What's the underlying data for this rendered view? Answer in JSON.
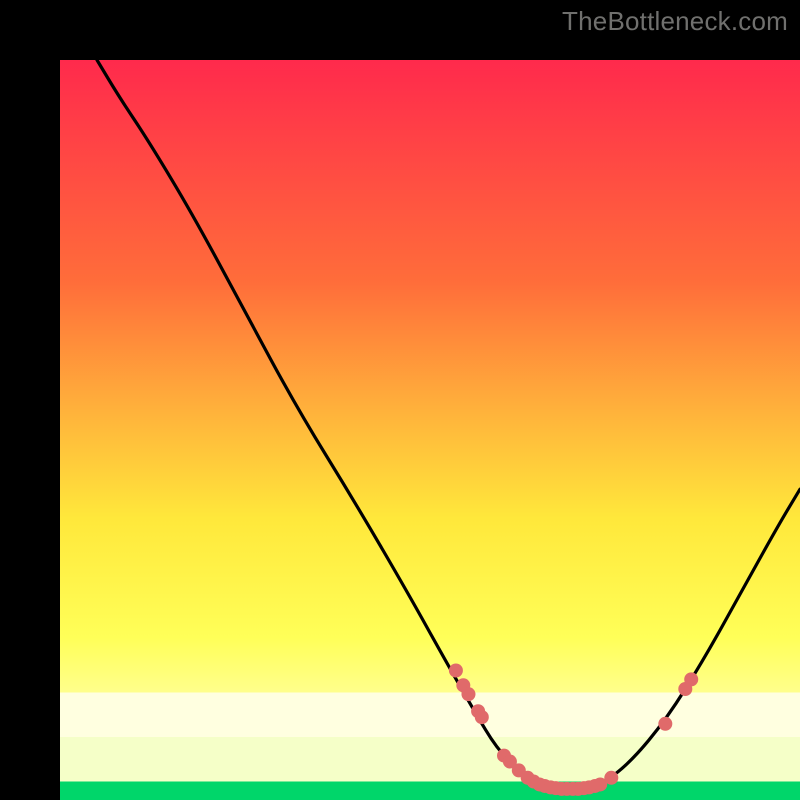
{
  "watermark": "TheBottleneck.com",
  "chart_data": {
    "type": "line",
    "xlabel": "",
    "ylabel": "",
    "xlim": [
      0,
      100
    ],
    "ylim": [
      0,
      100
    ],
    "title": "",
    "grid": false,
    "background_gradient": {
      "top": "#ff2a4c",
      "mid_upper": "#ffb43b",
      "mid": "#ffe83b",
      "mid_lower": "#ffff8c",
      "bottom_band": "#ffffe0",
      "bottom_line": "#00d66a"
    },
    "curve": [
      {
        "x": 5.0,
        "y": 100.0
      },
      {
        "x": 8.0,
        "y": 95.0
      },
      {
        "x": 12.0,
        "y": 89.0
      },
      {
        "x": 18.0,
        "y": 79.0
      },
      {
        "x": 25.0,
        "y": 66.0
      },
      {
        "x": 32.0,
        "y": 53.0
      },
      {
        "x": 40.0,
        "y": 40.0
      },
      {
        "x": 47.0,
        "y": 28.0
      },
      {
        "x": 52.0,
        "y": 19.0
      },
      {
        "x": 56.0,
        "y": 12.0
      },
      {
        "x": 59.0,
        "y": 7.0
      },
      {
        "x": 62.0,
        "y": 4.0
      },
      {
        "x": 65.0,
        "y": 2.0
      },
      {
        "x": 69.0,
        "y": 1.5
      },
      {
        "x": 73.0,
        "y": 2.0
      },
      {
        "x": 77.0,
        "y": 5.0
      },
      {
        "x": 82.0,
        "y": 11.0
      },
      {
        "x": 87.0,
        "y": 19.0
      },
      {
        "x": 92.0,
        "y": 28.0
      },
      {
        "x": 97.0,
        "y": 37.0
      },
      {
        "x": 100.0,
        "y": 42.0
      }
    ],
    "markers": [
      {
        "x": 53.5,
        "y": 17.5
      },
      {
        "x": 54.5,
        "y": 15.5
      },
      {
        "x": 55.2,
        "y": 14.3
      },
      {
        "x": 56.5,
        "y": 12.0
      },
      {
        "x": 57.0,
        "y": 11.2
      },
      {
        "x": 60.0,
        "y": 6.0
      },
      {
        "x": 60.8,
        "y": 5.2
      },
      {
        "x": 62.0,
        "y": 4.0
      },
      {
        "x": 63.2,
        "y": 3.0
      },
      {
        "x": 64.0,
        "y": 2.5
      },
      {
        "x": 64.8,
        "y": 2.1
      },
      {
        "x": 65.5,
        "y": 1.9
      },
      {
        "x": 66.3,
        "y": 1.7
      },
      {
        "x": 67.0,
        "y": 1.6
      },
      {
        "x": 67.8,
        "y": 1.5
      },
      {
        "x": 68.5,
        "y": 1.5
      },
      {
        "x": 69.3,
        "y": 1.5
      },
      {
        "x": 70.0,
        "y": 1.5
      },
      {
        "x": 70.8,
        "y": 1.6
      },
      {
        "x": 71.5,
        "y": 1.7
      },
      {
        "x": 72.3,
        "y": 1.9
      },
      {
        "x": 73.0,
        "y": 2.1
      },
      {
        "x": 74.5,
        "y": 3.0
      },
      {
        "x": 81.8,
        "y": 10.3
      },
      {
        "x": 84.5,
        "y": 15.0
      },
      {
        "x": 85.3,
        "y": 16.3
      }
    ],
    "marker_radius_px": 7
  }
}
